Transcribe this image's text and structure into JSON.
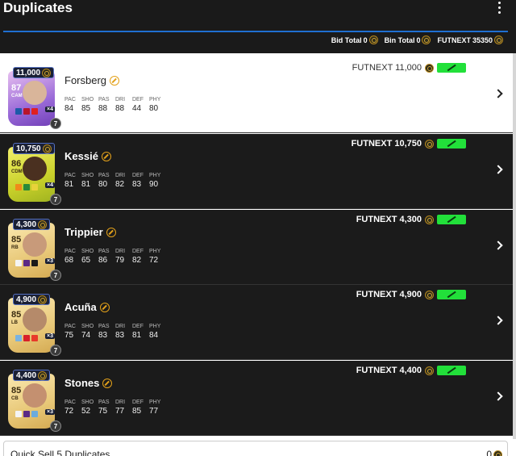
{
  "header": {
    "title": "Duplicates"
  },
  "totals": {
    "bid_label": "Bid Total",
    "bid_value": "0",
    "bin_label": "Bin Total",
    "bin_value": "0",
    "futnext_label": "FUTNEXT",
    "futnext_value": "35350"
  },
  "stat_labels": [
    "PAC",
    "SHO",
    "PAS",
    "DRI",
    "DEF",
    "PHY"
  ],
  "players": [
    {
      "name": "Forsberg",
      "price": "11,000",
      "rating": "87",
      "position": "CAM",
      "count": "×4",
      "level": "7",
      "futnext": "FUTNEXT 11,000",
      "stats": [
        "84",
        "85",
        "88",
        "88",
        "44",
        "80"
      ]
    },
    {
      "name": "Kessié",
      "price": "10,750",
      "rating": "86",
      "position": "CDM",
      "count": "×4",
      "level": "7",
      "futnext": "FUTNEXT 10,750",
      "stats": [
        "81",
        "81",
        "80",
        "82",
        "83",
        "90"
      ]
    },
    {
      "name": "Trippier",
      "price": "4,300",
      "rating": "85",
      "position": "RB",
      "count": "×3",
      "level": "7",
      "futnext": "FUTNEXT 4,300",
      "stats": [
        "68",
        "65",
        "86",
        "79",
        "82",
        "72"
      ]
    },
    {
      "name": "Acuña",
      "price": "4,900",
      "rating": "85",
      "position": "LB",
      "count": "×3",
      "level": "7",
      "futnext": "FUTNEXT 4,900",
      "stats": [
        "75",
        "74",
        "83",
        "83",
        "81",
        "84"
      ]
    },
    {
      "name": "Stones",
      "price": "4,400",
      "rating": "85",
      "position": "CB",
      "count": "×3",
      "level": "7",
      "futnext": "FUTNEXT 4,400",
      "stats": [
        "72",
        "52",
        "75",
        "77",
        "85",
        "77"
      ]
    }
  ],
  "quick_sell": {
    "label": "Quick Sell 5 Duplicates",
    "value": "0"
  },
  "colors": {
    "accent": "#1f6fd1",
    "green": "#22e03a",
    "coin": "#d4a634"
  }
}
